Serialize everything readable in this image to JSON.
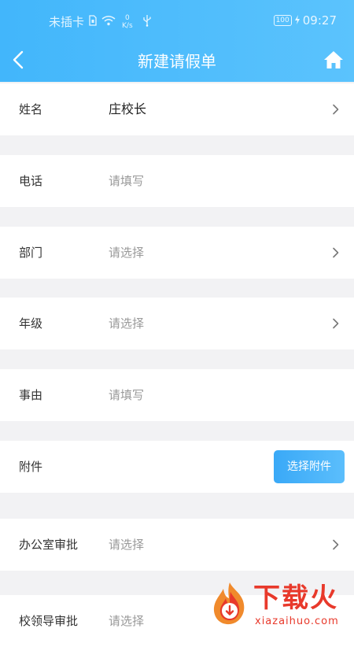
{
  "status_bar": {
    "carrier": "未插卡",
    "speed_value": "0",
    "speed_unit": "K/s",
    "battery": "100",
    "time": "09:27"
  },
  "nav": {
    "title": "新建请假单",
    "back_icon": "chevron-left-icon",
    "home_icon": "home-icon"
  },
  "form": {
    "rows": [
      {
        "label": "姓名",
        "value": "庄校长",
        "filled": true,
        "chevron": true
      },
      {
        "label": "电话",
        "value": "请填写",
        "filled": false,
        "chevron": false
      },
      {
        "label": "部门",
        "value": "请选择",
        "filled": false,
        "chevron": true
      },
      {
        "label": "年级",
        "value": "请选择",
        "filled": false,
        "chevron": true
      },
      {
        "label": "事由",
        "value": "请填写",
        "filled": false,
        "chevron": false
      },
      {
        "label": "附件",
        "value": "",
        "filled": false,
        "chevron": false,
        "button": "选择附件"
      },
      {
        "label": "办公室审批",
        "value": "请选择",
        "filled": false,
        "chevron": true
      },
      {
        "label": "校领导审批",
        "value": "请选择",
        "filled": false,
        "chevron": false
      }
    ]
  },
  "watermark": {
    "title": "下载火",
    "subtitle": "xiazaihuo.com"
  },
  "colors": {
    "header_start": "#42b6fb",
    "header_end": "#5bc3fd",
    "background": "#f2f2f4",
    "placeholder": "#999999",
    "label": "#333333",
    "button_start": "#3aa9f7",
    "button_end": "#5bbefc",
    "watermark": "#e8392b"
  }
}
